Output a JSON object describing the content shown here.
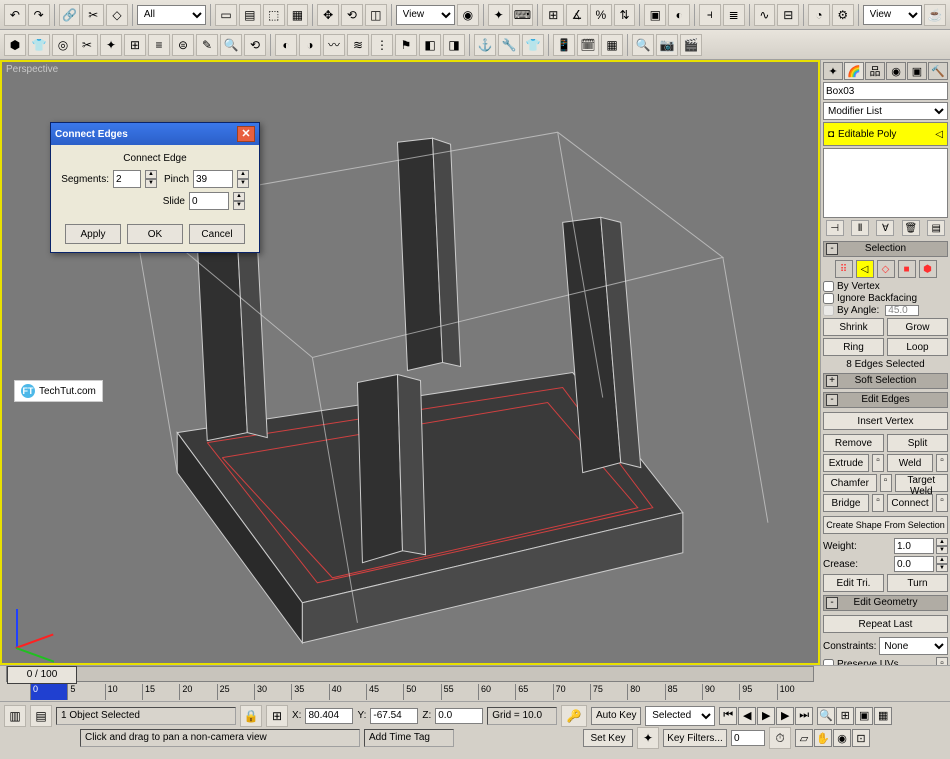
{
  "toolbar": {
    "filter_combo": "All",
    "view_combo1": "View",
    "view_combo2": "View"
  },
  "viewport": {
    "label": "Perspective",
    "watermark": "TechTut.com"
  },
  "dialog": {
    "title": "Connect Edges",
    "group_label": "Connect Edge",
    "segments_label": "Segments:",
    "segments_value": "2",
    "pinch_label": "Pinch",
    "pinch_value": "39",
    "slide_label": "Slide",
    "slide_value": "0",
    "apply": "Apply",
    "ok": "OK",
    "cancel": "Cancel"
  },
  "right": {
    "object_name": "Box03",
    "modifier_combo": "Modifier List",
    "stack_item": "Editable Poly",
    "selection_hd": "Selection",
    "by_vertex": "By Vertex",
    "ignore_backfacing": "Ignore Backfacing",
    "by_angle": "By Angle:",
    "by_angle_value": "45.0",
    "shrink": "Shrink",
    "grow": "Grow",
    "ring": "Ring",
    "loop": "Loop",
    "sel_info": "8 Edges Selected",
    "soft_sel_hd": "Soft Selection",
    "edit_edges_hd": "Edit Edges",
    "insert_vertex": "Insert Vertex",
    "remove": "Remove",
    "split": "Split",
    "extrude": "Extrude",
    "weld": "Weld",
    "chamfer": "Chamfer",
    "target_weld": "Target Weld",
    "bridge": "Bridge",
    "connect": "Connect",
    "create_shape": "Create Shape From Selection",
    "weight_label": "Weight:",
    "weight_value": "1.0",
    "crease_label": "Crease:",
    "crease_value": "0.0",
    "edit_tri": "Edit Tri.",
    "turn": "Turn",
    "edit_geom_hd": "Edit Geometry",
    "repeat_last": "Repeat Last",
    "constraints_label": "Constraints:",
    "constraints_value": "None",
    "preserve_uvs": "Preserve UVs"
  },
  "timeline": {
    "slider_label": "0 / 100",
    "ticks": [
      "0",
      "5",
      "10",
      "15",
      "20",
      "25",
      "30",
      "35",
      "40",
      "45",
      "50",
      "55",
      "60",
      "65",
      "70",
      "75",
      "80",
      "85",
      "90",
      "95",
      "100"
    ]
  },
  "status": {
    "selection": "1 Object Selected",
    "x_label": "X:",
    "x_value": "80.404",
    "y_label": "Y:",
    "y_value": "-67.54",
    "z_label": "Z:",
    "z_value": "0.0",
    "grid": "Grid = 10.0",
    "auto_key": "Auto Key",
    "set_key": "Set Key",
    "key_mode": "Selected",
    "key_filters": "Key Filters...",
    "hint": "Click and drag to pan a non-camera view",
    "add_time_tag": "Add Time Tag"
  }
}
